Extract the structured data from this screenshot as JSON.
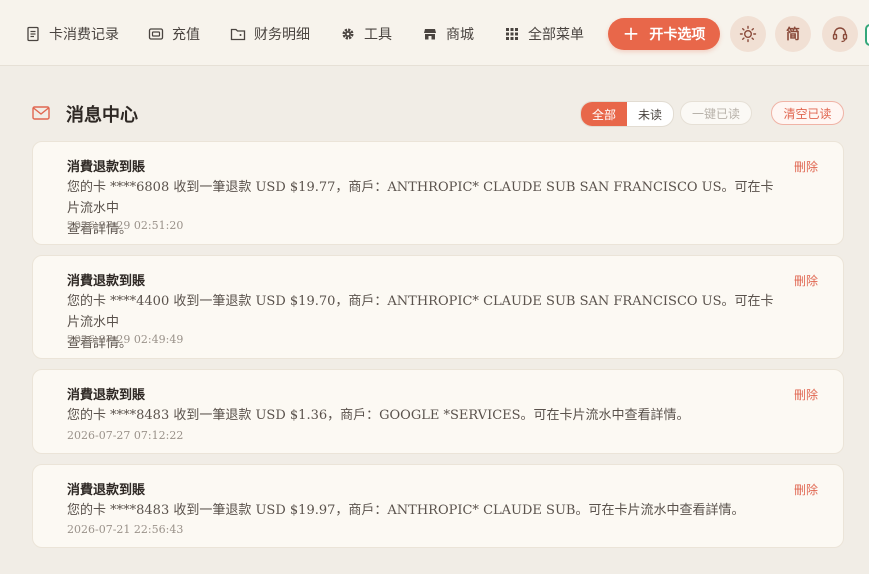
{
  "nav": {
    "items": [
      {
        "label": "卡消费记录",
        "icon": "receipt-icon"
      },
      {
        "label": "充值",
        "icon": "wallet-icon"
      },
      {
        "label": "财务明细",
        "icon": "folder-icon"
      },
      {
        "label": "工具",
        "icon": "gear-icon"
      },
      {
        "label": "商城",
        "icon": "shop-icon"
      },
      {
        "label": "全部菜单",
        "icon": "grid-icon"
      }
    ],
    "open_card_label": "开卡选项",
    "theme_icon": "sun-icon",
    "lang_label": "简",
    "support_icon": "headset-icon"
  },
  "header": {
    "title": "消息中心",
    "filters": {
      "all": "全部",
      "unread": "未读"
    },
    "mark_all_read": "一键已读",
    "clear_read": "清空已读"
  },
  "messages": [
    {
      "title": "消費退款到賬",
      "line1": "您的卡 ****6808 收到一筆退款 USD $19.77，商戶：ANTHROPIC* CLAUDE SUB SAN FRANCISCO US。可在卡片流水中",
      "line2": "查看詳情。",
      "time": "2026-07-29 02:51:20",
      "delete": "刪除"
    },
    {
      "title": "消費退款到賬",
      "line1": "您的卡 ****4400 收到一筆退款 USD $19.70，商戶：ANTHROPIC* CLAUDE SUB SAN FRANCISCO US。可在卡片流水中",
      "line2": "查看詳情。",
      "time": "2026-07-29 02:49:49",
      "delete": "刪除"
    },
    {
      "title": "消費退款到賬",
      "line1": "您的卡 ****8483 收到一筆退款 USD $1.36，商戶：GOOGLE *SERVICES。可在卡片流水中查看詳情。",
      "time": "2026-07-27 07:12:22",
      "delete": "刪除"
    },
    {
      "title": "消費退款到賬",
      "line1": "您的卡 ****8483 收到一筆退款 USD $19.97，商戶：ANTHROPIC* CLAUDE SUB。可在卡片流水中查看詳情。",
      "time": "2026-07-21 22:56:43",
      "delete": "刪除"
    }
  ]
}
